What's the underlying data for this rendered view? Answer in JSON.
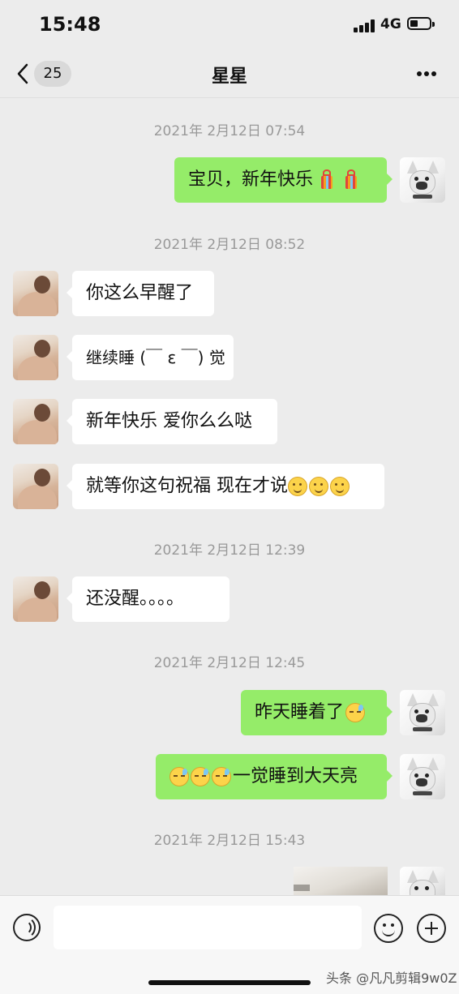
{
  "status": {
    "time": "15:48",
    "network": "4G"
  },
  "nav": {
    "unread_count": "25",
    "title": "星星"
  },
  "messages": {
    "ts1": "2021年 2月12日 07:54",
    "m1": "宝贝，新年快乐",
    "ts2": "2021年 2月12日 08:52",
    "m2": "你这么早醒了",
    "m3": "继续睡 (￣ ε ￣) 觉",
    "m4": "新年快乐 爱你么么哒",
    "m5": "就等你这句祝福 现在才说",
    "ts3": "2021年 2月12日 12:39",
    "m6": "还没醒。。。。",
    "ts4": "2021年 2月12日 12:45",
    "m7": "昨天睡着了",
    "m8": "一觉睡到大天亮",
    "ts5": "2021年 2月12日 15:43"
  },
  "watermark": "头条 @凡凡剪辑9w0Z",
  "icons": {
    "back": "back-chevron-icon",
    "more": "more-icon",
    "voice": "voice-icon",
    "emoji": "emoji-icon",
    "plus": "plus-icon",
    "emoji_in_messages": [
      "fireworks-emoji",
      "smile-emoji",
      "sleepy-emoji"
    ]
  },
  "colors": {
    "outgoing_bubble": "#95ec69",
    "incoming_bubble": "#ffffff",
    "background": "#ececec"
  }
}
